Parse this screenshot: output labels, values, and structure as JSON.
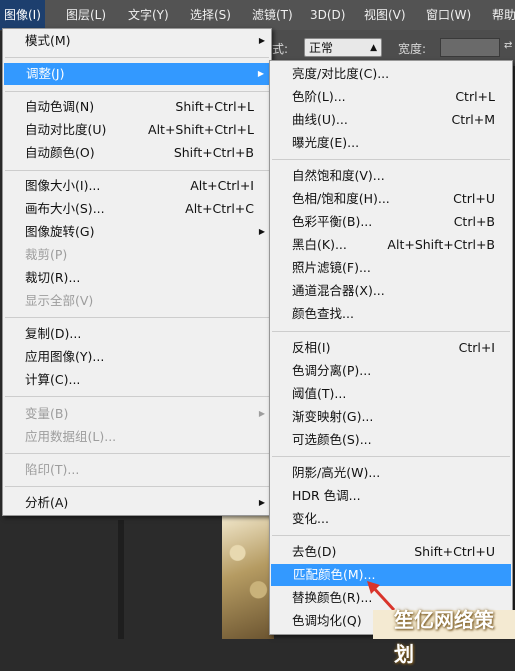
{
  "menubar": {
    "items": [
      "图像(I)",
      "图层(L)",
      "文字(Y)",
      "选择(S)",
      "滤镜(T)",
      "3D(D)",
      "视图(V)",
      "窗口(W)",
      "帮助"
    ]
  },
  "options_bar": {
    "style_label": "式:",
    "style_value": "正常",
    "width_label": "宽度:"
  },
  "image_menu": [
    {
      "label": "模式(M)",
      "submenu": true
    },
    {
      "label": "调整(J)",
      "submenu": true,
      "highlighted": true
    },
    {
      "label": "自动色调(N)",
      "shortcut": "Shift+Ctrl+L"
    },
    {
      "label": "自动对比度(U)",
      "shortcut": "Alt+Shift+Ctrl+L"
    },
    {
      "label": "自动颜色(O)",
      "shortcut": "Shift+Ctrl+B"
    },
    {
      "label": "图像大小(I)...",
      "shortcut": "Alt+Ctrl+I"
    },
    {
      "label": "画布大小(S)...",
      "shortcut": "Alt+Ctrl+C"
    },
    {
      "label": "图像旋转(G)",
      "submenu": true
    },
    {
      "label": "裁剪(P)",
      "disabled": true
    },
    {
      "label": "裁切(R)..."
    },
    {
      "label": "显示全部(V)",
      "disabled": true
    },
    {
      "label": "复制(D)..."
    },
    {
      "label": "应用图像(Y)..."
    },
    {
      "label": "计算(C)..."
    },
    {
      "label": "变量(B)",
      "submenu": true,
      "disabled": true
    },
    {
      "label": "应用数据组(L)...",
      "disabled": true
    },
    {
      "label": "陷印(T)...",
      "disabled": true
    },
    {
      "label": "分析(A)",
      "submenu": true
    }
  ],
  "adjust_menu": [
    {
      "label": "亮度/对比度(C)..."
    },
    {
      "label": "色阶(L)...",
      "shortcut": "Ctrl+L"
    },
    {
      "label": "曲线(U)...",
      "shortcut": "Ctrl+M"
    },
    {
      "label": "曝光度(E)..."
    },
    {
      "label": "自然饱和度(V)..."
    },
    {
      "label": "色相/饱和度(H)...",
      "shortcut": "Ctrl+U"
    },
    {
      "label": "色彩平衡(B)...",
      "shortcut": "Ctrl+B"
    },
    {
      "label": "黑白(K)...",
      "shortcut": "Alt+Shift+Ctrl+B"
    },
    {
      "label": "照片滤镜(F)..."
    },
    {
      "label": "通道混合器(X)..."
    },
    {
      "label": "颜色查找..."
    },
    {
      "label": "反相(I)",
      "shortcut": "Ctrl+I"
    },
    {
      "label": "色调分离(P)..."
    },
    {
      "label": "阈值(T)..."
    },
    {
      "label": "渐变映射(G)..."
    },
    {
      "label": "可选颜色(S)..."
    },
    {
      "label": "阴影/高光(W)..."
    },
    {
      "label": "HDR 色调..."
    },
    {
      "label": "变化..."
    },
    {
      "label": "去色(D)",
      "shortcut": "Shift+Ctrl+U"
    },
    {
      "label": "匹配颜色(M)...",
      "highlighted": true
    },
    {
      "label": "替换颜色(R)..."
    },
    {
      "label": "色调均化(Q)"
    }
  ],
  "watermark": {
    "text": "笙亿网络策划"
  },
  "colors": {
    "highlight": "#3399ff",
    "menu_bg": "#f0f0f0",
    "menubar_bg": "#535353",
    "annotation_arrow": "#d9342b"
  }
}
